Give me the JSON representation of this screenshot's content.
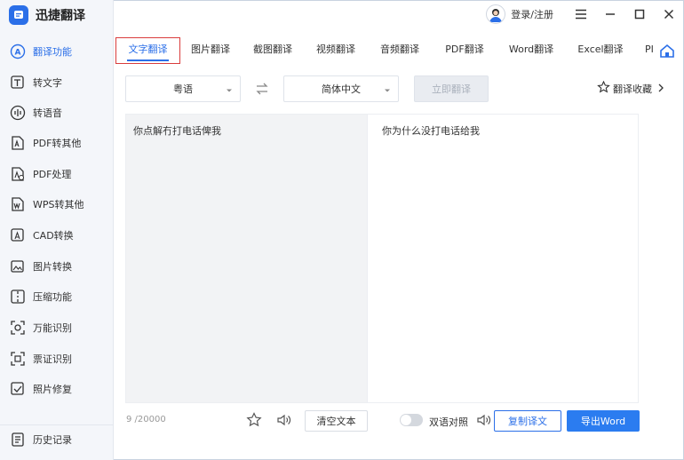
{
  "app": {
    "title": "迅捷翻译"
  },
  "titlebar": {
    "login_label": "登录/注册"
  },
  "sidebar": {
    "items": [
      {
        "label": "翻译功能",
        "icon": "translate-icon"
      },
      {
        "label": "转文字",
        "icon": "text-convert-icon"
      },
      {
        "label": "转语音",
        "icon": "voice-icon"
      },
      {
        "label": "PDF转其他",
        "icon": "pdf-convert-icon"
      },
      {
        "label": "PDF处理",
        "icon": "pdf-process-icon"
      },
      {
        "label": "WPS转其他",
        "icon": "wps-convert-icon"
      },
      {
        "label": "CAD转换",
        "icon": "cad-icon"
      },
      {
        "label": "图片转换",
        "icon": "image-convert-icon"
      },
      {
        "label": "压缩功能",
        "icon": "compress-icon"
      },
      {
        "label": "万能识别",
        "icon": "recognize-icon"
      },
      {
        "label": "票证识别",
        "icon": "ticket-icon"
      },
      {
        "label": "照片修复",
        "icon": "photo-repair-icon"
      }
    ],
    "history_label": "历史记录"
  },
  "tabs": [
    {
      "label": "文字翻译"
    },
    {
      "label": "图片翻译"
    },
    {
      "label": "截图翻译"
    },
    {
      "label": "视频翻译"
    },
    {
      "label": "音频翻译"
    },
    {
      "label": "PDF翻译"
    },
    {
      "label": "Word翻译"
    },
    {
      "label": "Excel翻译"
    },
    {
      "label": "PI"
    }
  ],
  "toolbar": {
    "source_lang": "粤语",
    "target_lang": "简体中文",
    "translate_label": "立即翻译",
    "favorites_label": "翻译收藏"
  },
  "editor": {
    "source_text": "你点解冇打电话俾我",
    "target_text": "你为什么没打电话给我",
    "char_count": "9 /20000"
  },
  "bottom": {
    "clear_label": "清空文本",
    "bilingual_label": "双语对照",
    "bilingual_on": false,
    "copy_label": "复制译文",
    "export_label": "导出Word"
  },
  "colors": {
    "accent": "#2b6fe8",
    "highlight_border": "#d93c3c"
  }
}
